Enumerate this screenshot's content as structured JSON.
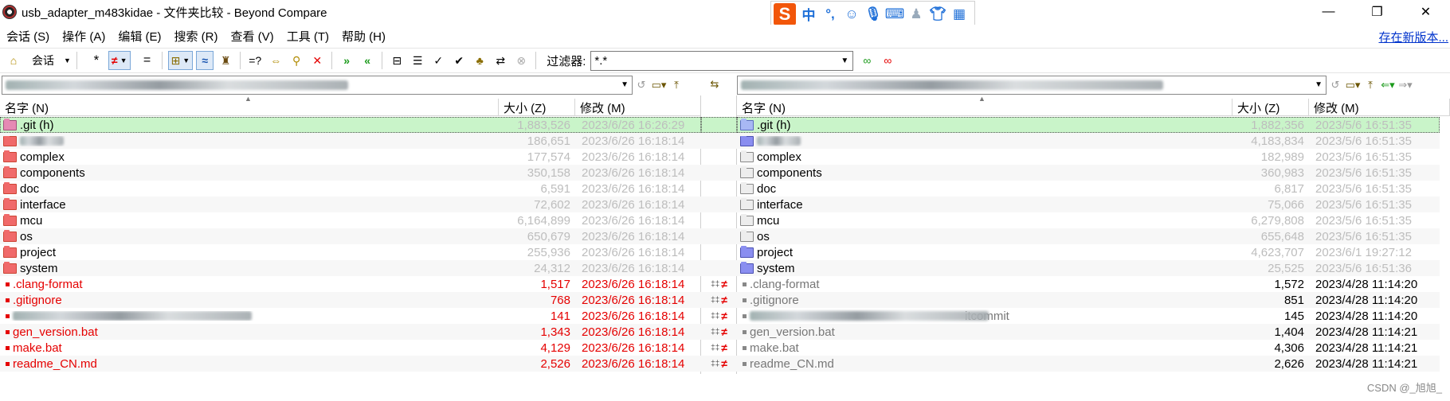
{
  "window": {
    "title": "usb_adapter_m483kidae - 文件夹比较 - Beyond Compare",
    "minimize": "—",
    "restore": "❐",
    "close": "✕"
  },
  "ime": {
    "logo": "S",
    "lang": "中",
    "punct": "°,"
  },
  "menu": [
    "会话 (S)",
    "操作 (A)",
    "编辑 (E)",
    "搜索 (R)",
    "查看 (V)",
    "工具 (T)",
    "帮助 (H)"
  ],
  "update_link": "存在新版本...",
  "toolbar": {
    "session_label": "会话",
    "all": "*",
    "diff": "≠",
    "same": "=",
    "approx": "≈",
    "compare": "=?",
    "filter_label": "过滤器:",
    "filter_value": "*.*"
  },
  "left": {
    "headers": {
      "name": "名字 (N)",
      "size": "大小 (Z)",
      "modified": "修改 (M)"
    },
    "rows": [
      {
        "name": ".git (h)",
        "size": "1,883,526",
        "date": "2023/6/26 16:26:29",
        "kind": "folder",
        "icon": "redpurple",
        "color": "black",
        "sel": true
      },
      {
        "name": "",
        "size": "186,651",
        "date": "2023/6/26 16:18:14",
        "kind": "folder",
        "icon": "red",
        "color": "black",
        "blurred": true
      },
      {
        "name": "complex",
        "size": "177,574",
        "date": "2023/6/26 16:18:14",
        "kind": "folder",
        "icon": "red",
        "color": "black"
      },
      {
        "name": "components",
        "size": "350,158",
        "date": "2023/6/26 16:18:14",
        "kind": "folder",
        "icon": "red",
        "color": "black"
      },
      {
        "name": "doc",
        "size": "6,591",
        "date": "2023/6/26 16:18:14",
        "kind": "folder",
        "icon": "red",
        "color": "black"
      },
      {
        "name": "interface",
        "size": "72,602",
        "date": "2023/6/26 16:18:14",
        "kind": "folder",
        "icon": "red",
        "color": "black"
      },
      {
        "name": "mcu",
        "size": "6,164,899",
        "date": "2023/6/26 16:18:14",
        "kind": "folder",
        "icon": "red",
        "color": "black"
      },
      {
        "name": "os",
        "size": "650,679",
        "date": "2023/6/26 16:18:14",
        "kind": "folder",
        "icon": "red",
        "color": "black"
      },
      {
        "name": "project",
        "size": "255,936",
        "date": "2023/6/26 16:18:14",
        "kind": "folder",
        "icon": "red",
        "color": "black"
      },
      {
        "name": "system",
        "size": "24,312",
        "date": "2023/6/26 16:18:14",
        "kind": "folder",
        "icon": "red",
        "color": "black"
      },
      {
        "name": ".clang-format",
        "size": "1,517",
        "date": "2023/6/26 16:18:14",
        "kind": "file",
        "color": "red"
      },
      {
        "name": ".gitignore",
        "size": "768",
        "date": "2023/6/26 16:18:14",
        "kind": "file",
        "color": "red"
      },
      {
        "name": "",
        "size": "141",
        "date": "2023/6/26 16:18:14",
        "kind": "file",
        "color": "red",
        "blurred": true
      },
      {
        "name": "gen_version.bat",
        "size": "1,343",
        "date": "2023/6/26 16:18:14",
        "kind": "file",
        "color": "red"
      },
      {
        "name": "make.bat",
        "size": "4,129",
        "date": "2023/6/26 16:18:14",
        "kind": "file",
        "color": "red"
      },
      {
        "name": "readme_CN.md",
        "size": "2,526",
        "date": "2023/6/26 16:18:14",
        "kind": "file",
        "color": "red"
      }
    ]
  },
  "right": {
    "headers": {
      "name": "名字 (N)",
      "size": "大小 (Z)",
      "modified": "修改 (M)"
    },
    "rows": [
      {
        "name": ".git (h)",
        "size": "1,882,356",
        "date": "2023/5/6 16:51:35",
        "kind": "folder",
        "icon": "lightblue",
        "color": "black",
        "sel": true
      },
      {
        "name": "",
        "size": "4,183,834",
        "date": "2023/5/6 16:51:35",
        "kind": "folder",
        "icon": "blue",
        "color": "black",
        "blurred": true
      },
      {
        "name": "complex",
        "size": "182,989",
        "date": "2023/5/6 16:51:35",
        "kind": "folder",
        "icon": "grayf",
        "color": "black"
      },
      {
        "name": "components",
        "size": "360,983",
        "date": "2023/5/6 16:51:35",
        "kind": "folder",
        "icon": "grayf",
        "color": "black"
      },
      {
        "name": "doc",
        "size": "6,817",
        "date": "2023/5/6 16:51:35",
        "kind": "folder",
        "icon": "grayf",
        "color": "black"
      },
      {
        "name": "interface",
        "size": "75,066",
        "date": "2023/5/6 16:51:35",
        "kind": "folder",
        "icon": "grayf",
        "color": "black"
      },
      {
        "name": "mcu",
        "size": "6,279,808",
        "date": "2023/5/6 16:51:35",
        "kind": "folder",
        "icon": "grayf",
        "color": "black"
      },
      {
        "name": "os",
        "size": "655,648",
        "date": "2023/5/6 16:51:35",
        "kind": "folder",
        "icon": "grayf",
        "color": "black"
      },
      {
        "name": "project",
        "size": "4,623,707",
        "date": "2023/6/1 19:27:12",
        "kind": "folder",
        "icon": "blue",
        "color": "black"
      },
      {
        "name": "system",
        "size": "25,525",
        "date": "2023/5/6 16:51:36",
        "kind": "folder",
        "icon": "blue",
        "color": "black"
      },
      {
        "name": ".clang-format",
        "size": "1,572",
        "date": "2023/4/28 11:14:20",
        "kind": "file",
        "color": "darkgray"
      },
      {
        "name": ".gitignore",
        "size": "851",
        "date": "2023/4/28 11:14:20",
        "kind": "file",
        "color": "darkgray"
      },
      {
        "name": "itcommit",
        "size": "145",
        "date": "2023/4/28 11:14:20",
        "kind": "file",
        "color": "darkgray",
        "blurred": true
      },
      {
        "name": "gen_version.bat",
        "size": "1,404",
        "date": "2023/4/28 11:14:21",
        "kind": "file",
        "color": "darkgray"
      },
      {
        "name": "make.bat",
        "size": "4,306",
        "date": "2023/4/28 11:14:21",
        "kind": "file",
        "color": "darkgray"
      },
      {
        "name": "readme_CN.md",
        "size": "2,626",
        "date": "2023/4/28 11:14:21",
        "kind": "file",
        "color": "darkgray"
      }
    ]
  },
  "diff_marks": {
    "rows_start": 10,
    "rows_end": 15,
    "mark": "≠",
    "sub": "‡‡"
  },
  "watermark": "CSDN @_旭旭_"
}
